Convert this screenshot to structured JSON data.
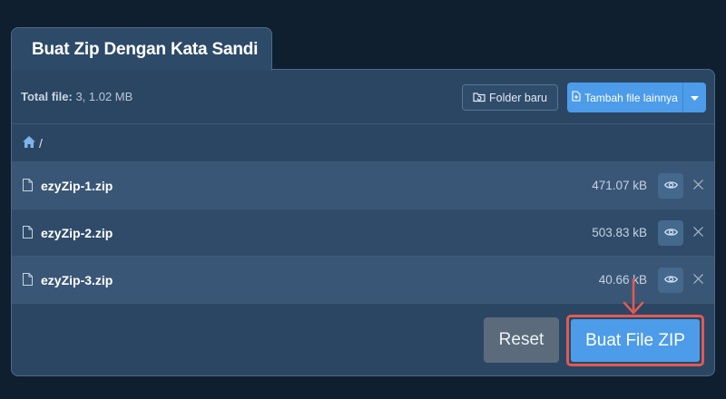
{
  "tab": {
    "title": "Buat Zip Dengan Kata Sandi"
  },
  "toolbar": {
    "total_label": "Total file:",
    "total_value": "3, 1.02 MB",
    "folder_button": "Folder baru",
    "add_button": "Tambah file lainnya"
  },
  "breadcrumb": {
    "separator": "/"
  },
  "files": [
    {
      "name": "ezyZip-1.zip",
      "size": "471.07 kB"
    },
    {
      "name": "ezyZip-2.zip",
      "size": "503.83 kB"
    },
    {
      "name": "ezyZip-3.zip",
      "size": "40.66 kB"
    }
  ],
  "actions": {
    "reset": "Reset",
    "create": "Buat File ZIP"
  },
  "colors": {
    "accent": "#4d9cea",
    "highlight": "#e05a55",
    "background": "#0f1f30",
    "panel": "#2b4663"
  },
  "icons": [
    "home-icon",
    "file-icon",
    "eye-icon",
    "close-icon",
    "folder-refresh-icon",
    "file-plus-icon",
    "caret-down-icon",
    "arrow-down-icon"
  ]
}
